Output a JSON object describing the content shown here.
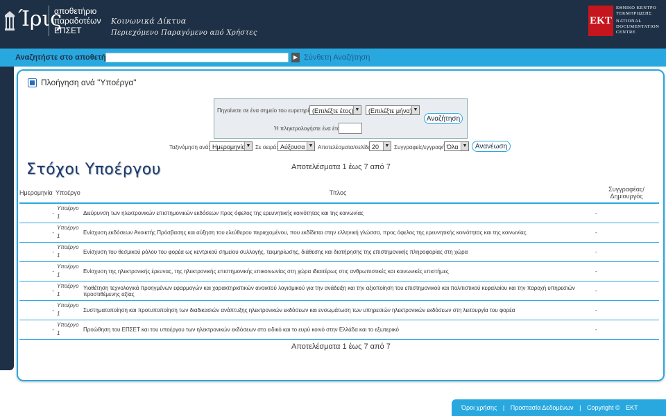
{
  "header": {
    "logo": "Ίρις",
    "logo_lines": [
      "αποθετήριο",
      "παραδοτέων",
      "ΕΠΣΕΤ"
    ],
    "tagline_1": "Κοινωνικά Δίκτυα",
    "tagline_2": "Περιεχόμενο Παραγόμενο από Χρήστες",
    "ekt_mark": "ΕΚΤ",
    "ekt_lines": [
      "ΕΘΝΙΚΟ ΚΕΝΤΡΟ",
      "ΤΕΚΜΗΡΙΩΣΗΣ",
      "NATIONAL",
      "DOCUMENTATION",
      "CENTRE"
    ]
  },
  "search": {
    "label": "Αναζητήστε στο αποθετήριο",
    "value": "",
    "go_glyph": "▶",
    "advanced": "Σύνθετη Αναζήτηση"
  },
  "browse": {
    "title": "Πλοήγηση ανά \"Υποέργα\"",
    "jump_label": "Πηγαίνετε σε ένα σημείο του ευρετηρίου:",
    "year_select": "(Επιλέξτε έτος)",
    "month_select": "(Επιλέξτε μήνα)",
    "search_button": "Αναζήτηση",
    "type_year_label": "Ή πληκτρολογήστε ένα έτος:",
    "type_year_value": "",
    "sort_by_label": "Ταξινόμηση ανά:",
    "sort_by_value": "Ημερομηνία",
    "order_label": "Σε σειρά:",
    "order_value": "Αύξουσα",
    "rpp_label": "Αποτελέσματα/σελίδα:",
    "rpp_value": "20",
    "authors_label": "Συγγραφείς/εγγραφή:",
    "authors_value": "Όλα",
    "refresh_button": "Ανανέωση",
    "results_text": "Αποτελέσματα 1 έως 7 από 7"
  },
  "goals_title": "Στόχοι Υποέργου",
  "table": {
    "headers": {
      "date": "Ημερομηνία",
      "subproject": "Υποέργο",
      "title": "Τίτλος",
      "author": "Συγγραφέας/ Δημιουργός"
    },
    "rows": [
      {
        "date": "-",
        "sub": "Υποέργο 1",
        "title": "Διεύρυνση των ηλεκτρονικών επιστημονικών εκδόσεων προς όφελος της ερευνητικής κοινότητας και της κοινωνίας",
        "author": "-"
      },
      {
        "date": "-",
        "sub": "Υποέργο 1",
        "title": "Ενίσχυση εκδόσεων Ανοικτής Πρόσβασης και αύξηση του ελεύθερου περιεχομένου, που εκδίδεται στην ελληνική γλώσσα, προς όφελος της ερευνητικής κοινότητας και της κοινωνίας",
        "author": "-"
      },
      {
        "date": "-",
        "sub": "Υποέργο 1",
        "title": "Ενίσχυση του θεσμικού ρόλου του φορέα ως κεντρικού σημείου συλλογής, τεκμηρίωσης, διάθεσης και διατήρησης της επιστημονικής πληροφορίας στη χώρα",
        "author": "-"
      },
      {
        "date": "-",
        "sub": "Υποέργο 1",
        "title": "Ενίσχυση της ηλεκτρονικής έρευνας, της ηλεκτρονικής επιστημονικής επικοινωνίας στη χώρα ιδιαιτέρως στις ανθρωπιστικές και κοινωνικές επιστήμες",
        "author": "-"
      },
      {
        "date": "-",
        "sub": "Υποέργο 1",
        "title": "Υιοθέτηση τεχνολογικά προηγμένων εφαρμογών και χαρακτηριστικών ανοικτού λογισμικού για την ανάδειξη και την αξιοποίηση του επιστημονικού και πολιτιστικού κεφαλαίου και την παροχή υπηρεσιών προστιθέμενης αξίας",
        "author": "-"
      },
      {
        "date": "-",
        "sub": "Υποέργο 1",
        "title": "Συστηματοποίηση και προτυποποίηση των διαδικασιών ανάπτυξης ηλεκτρονικών εκδόσεων και ενσωμάτωση των υπηρεσιών ηλεκτρονικών εκδόσεων στη λειτουργία του φορέα",
        "author": "-"
      },
      {
        "date": "-",
        "sub": "Υποέργο 1",
        "title": "Προώθηση του ΕΠΣΕΤ και του υποέργου των ηλεκτρονικών εκδόσεων στο ειδικό και το ευρύ κοινό στην Ελλάδα και το εξωτερικό",
        "author": "-"
      }
    ]
  },
  "footer": {
    "terms": "Όροι χρήσης",
    "sep": "|",
    "privacy": "Προστασία Δεδομένων",
    "copyright": "Copyright ©",
    "ekt": "ΕΚΤ"
  }
}
